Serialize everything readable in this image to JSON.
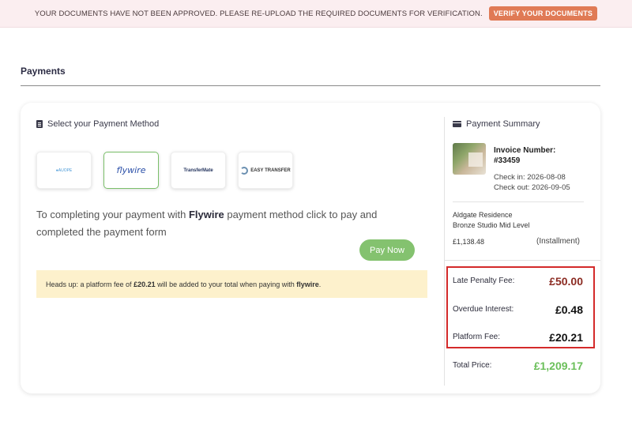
{
  "banner": {
    "message": "YOUR DOCUMENTS HAVE NOT BEEN APPROVED. PLEASE RE-UPLOAD THE REQUIRED DOCUMENTS FOR VERIFICATION.",
    "button_label": "VERIFY YOUR DOCUMENTS",
    "accent_color": "#e07a55"
  },
  "page": {
    "title": "Payments"
  },
  "payment_methods": {
    "heading": "Select your Payment Method",
    "methods": [
      {
        "name": "Unknown provider",
        "logo_text": "●AUOPE",
        "selected": false
      },
      {
        "name": "Flywire",
        "logo_text": "flywire",
        "selected": true
      },
      {
        "name": "TransferMate",
        "logo_text": "TransferMate",
        "selected": false
      },
      {
        "name": "Easy Transfer",
        "logo_text": "EASY TRANSFER",
        "selected": false
      }
    ],
    "description_prefix": "To completing your payment with ",
    "description_method": "Flywire",
    "description_suffix": " payment method click to pay and completed the payment form",
    "pay_button_label": "Pay Now",
    "note_prefix": "Heads up: a platform fee of ",
    "note_fee": "£20.21",
    "note_middle": " will be added to your total when paying with ",
    "note_method": "flywire",
    "note_end": "."
  },
  "summary": {
    "heading": "Payment Summary",
    "invoice_label": "Invoice Number:",
    "invoice_number": "#33459",
    "check_in": "Check in: 2026-08-08",
    "check_out": "Check out: 2026-09-05",
    "residence": "Aldgate Residence",
    "room_type": "Bronze Studio Mid Level",
    "room_price": "£1,138.48",
    "payment_plan": "(Installment)",
    "fees": [
      {
        "label": "Late Penalty Fee:",
        "value": "£50.00"
      },
      {
        "label": "Overdue Interest:",
        "value": "£0.48"
      },
      {
        "label": "Platform Fee:",
        "value": "£20.21"
      }
    ],
    "total_label": "Total Price:",
    "total_value": "£1,209.17",
    "highlight_color": "#d42a2a",
    "total_color": "#6bbf5a"
  }
}
